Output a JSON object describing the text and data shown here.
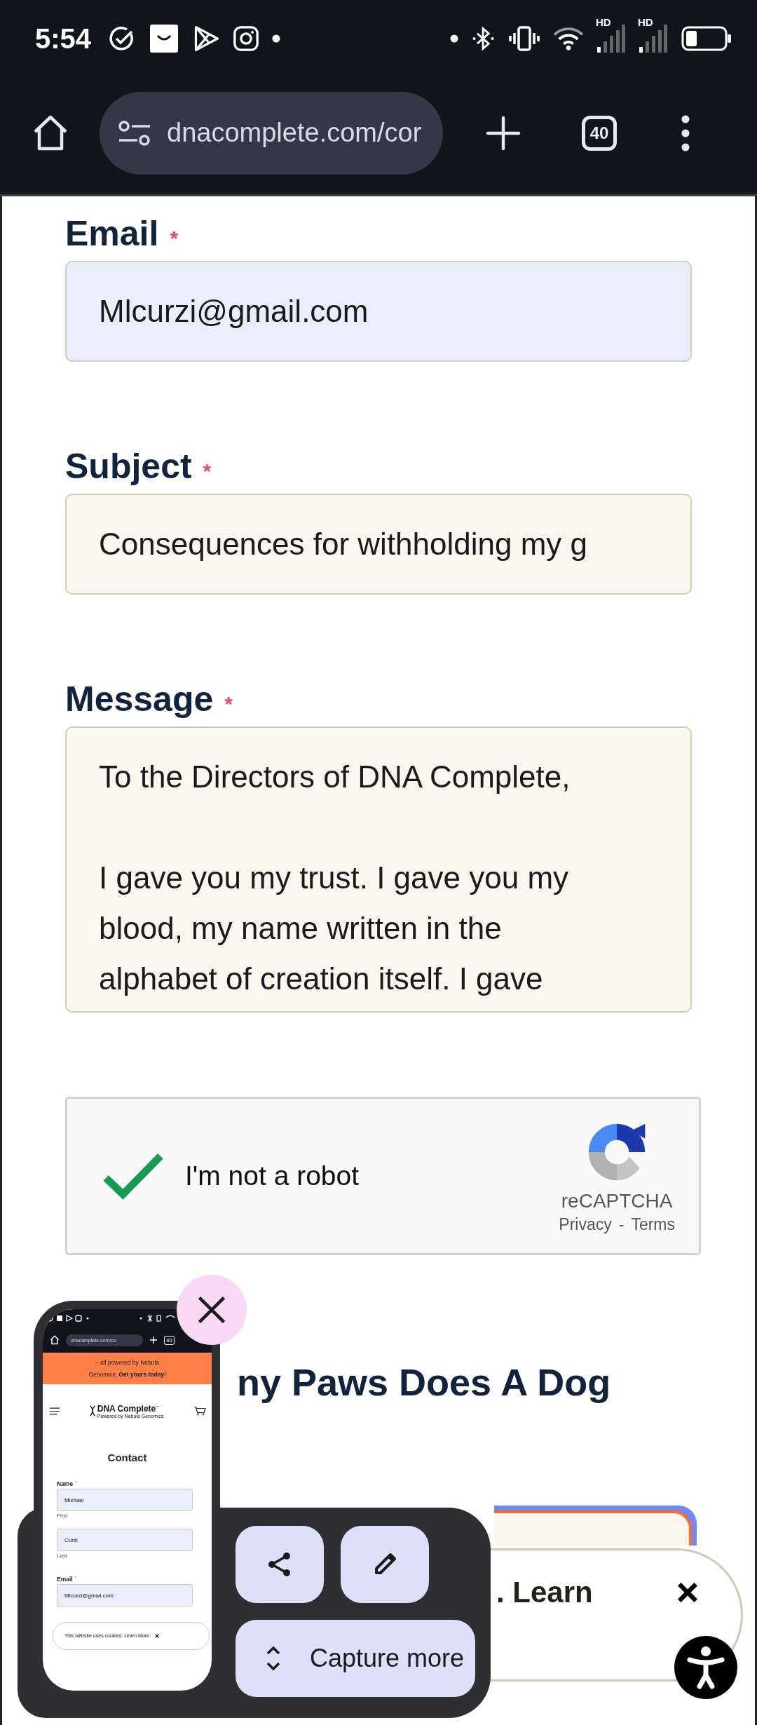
{
  "status_bar": {
    "time": "5:54",
    "network": [
      {
        "label": "HD"
      },
      {
        "label": "HD"
      }
    ]
  },
  "browser": {
    "url": "dnacomplete.com/cor",
    "tab_count": "40"
  },
  "form": {
    "fields": [
      {
        "kind": "input",
        "label": "Email",
        "required_mark": "*",
        "autofilled": true,
        "lines": [
          "Mlcurzi@gmail.com"
        ]
      },
      {
        "kind": "input",
        "label": "Subject",
        "required_mark": "*",
        "autofilled": false,
        "lines": [
          "Consequences for withholding my g"
        ]
      },
      {
        "kind": "textarea",
        "label": "Message",
        "required_mark": "*",
        "autofilled": false,
        "paragraphs": [
          [
            "To the Directors of DNA Complete,"
          ],
          [
            "I gave you my trust. I gave you my",
            "blood, my name written in the",
            "alphabet of creation itself. I gave"
          ]
        ]
      }
    ],
    "captcha": {
      "checked": true,
      "label": "I'm not a robot",
      "brand": "reCAPTCHA",
      "links": [
        "Privacy",
        "-",
        "Terms"
      ]
    }
  },
  "heading": "ny Paws Does A Dog",
  "cookie_banner": {
    "text": ". Learn"
  },
  "screenshot_tool": {
    "capture_more": "Capture more",
    "thumbnail": {
      "url": "dnacomplete.com/co",
      "tab_count": "40",
      "banner_lines": [
        "– all powered by Nebula",
        "Genomics. **Get yours today**!"
      ],
      "logo": "DNA Complete",
      "logo_mark": "™",
      "tagline": "Powered by Nebula Genomics",
      "title": "Contact",
      "fields": [
        {
          "label": "Name",
          "required_mark": "*",
          "value": "Michael",
          "hint": "First"
        },
        {
          "value": "Curzi",
          "hint": "Last"
        },
        {
          "label": "Email",
          "required_mark": "*",
          "value": "Mlcurzi@gmail.com"
        }
      ],
      "cookie": "This website uses cookies. Learn More."
    }
  }
}
